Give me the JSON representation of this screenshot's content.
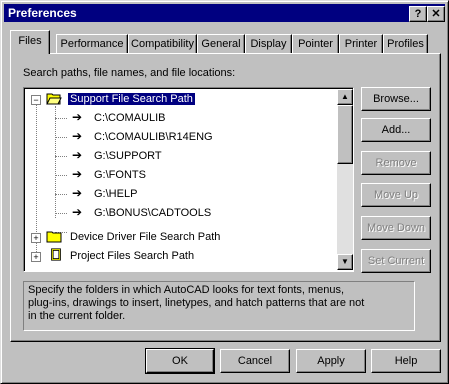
{
  "window": {
    "title": "Preferences",
    "help_glyph": "?",
    "close_glyph": "✕"
  },
  "tabs": [
    {
      "label": "Files",
      "active": true
    },
    {
      "label": "Performance"
    },
    {
      "label": "Compatibility"
    },
    {
      "label": "General"
    },
    {
      "label": "Display"
    },
    {
      "label": "Pointer"
    },
    {
      "label": "Printer"
    },
    {
      "label": "Profiles"
    }
  ],
  "files_tab": {
    "list_label": "Search paths, file names, and file locations:",
    "tree": {
      "root": {
        "label": "Support File Search Path",
        "expanded": true,
        "exp_glyph": "−"
      },
      "children": [
        "C:\\COMAULIB",
        "C:\\COMAULIB\\R14ENG",
        "G:\\SUPPORT",
        "G:\\FONTS",
        "G:\\HELP",
        "G:\\BONUS\\CADTOOLS"
      ],
      "collapsed": [
        {
          "label": "Device Driver File Search Path",
          "exp_glyph": "+"
        },
        {
          "label": "Project Files Search Path",
          "exp_glyph": "+"
        }
      ]
    },
    "buttons": {
      "browse": "Browse...",
      "add": "Add...",
      "remove": "Remove",
      "move_up": "Move Up",
      "move_down": "Move Down",
      "set_current": "Set Current"
    },
    "description": "Specify the folders in which AutoCAD looks for text fonts, menus,\nplug-ins, drawings to insert, linetypes, and hatch patterns that are not\nin the current folder."
  },
  "footer": {
    "ok": "OK",
    "cancel": "Cancel",
    "apply": "Apply",
    "help": "Help"
  },
  "colors": {
    "title_bg": "#000080",
    "selection": "#000080",
    "face": "#c0c0c0"
  }
}
